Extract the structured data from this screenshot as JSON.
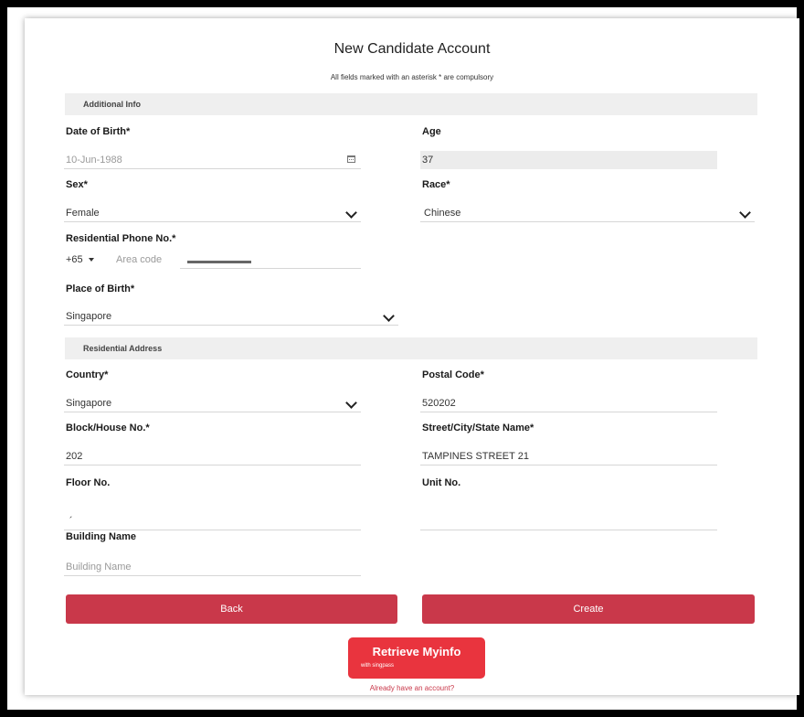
{
  "header": {
    "title": "New Candidate Account",
    "subtitle": "All fields marked with an asterisk * are compulsory"
  },
  "sections": {
    "additional": "Additional Info",
    "residential": "Residential Address"
  },
  "fields": {
    "dob": {
      "label": "Date of Birth*",
      "value": "10-Jun-1988"
    },
    "age": {
      "label": "Age",
      "value": "37"
    },
    "sex": {
      "label": "Sex*",
      "value": "Female"
    },
    "race": {
      "label": "Race*",
      "value": "Chinese"
    },
    "phone": {
      "label": "Residential Phone No.*",
      "country_code": "+65",
      "area_placeholder": "Area code"
    },
    "place_of_birth": {
      "label": "Place of Birth*",
      "value": "Singapore"
    },
    "country": {
      "label": "Country*",
      "value": "Singapore"
    },
    "postal_code": {
      "label": "Postal Code*",
      "value": "520202"
    },
    "block": {
      "label": "Block/House No.*",
      "value": "202"
    },
    "street": {
      "label": "Street/City/State Name*",
      "value": "TAMPINES STREET 21"
    },
    "floor": {
      "label": "Floor No.",
      "value": "´"
    },
    "unit": {
      "label": "Unit No.",
      "value": ""
    },
    "building": {
      "label": "Building Name",
      "placeholder": "Building Name"
    }
  },
  "buttons": {
    "back": "Back",
    "create": "Create",
    "myinfo_main": "Retrieve Myinfo",
    "myinfo_sub": "with singpass"
  },
  "links": {
    "existing_account": "Already have an account?"
  },
  "icons": {
    "calendar": "calendar-icon",
    "chevron": "chevron-down-icon"
  },
  "colors": {
    "primary": "#c9384a",
    "myinfo": "#e9343e"
  }
}
